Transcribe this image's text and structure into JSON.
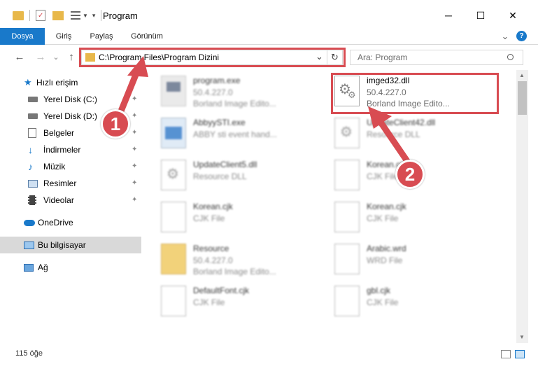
{
  "window": {
    "title": "Program",
    "minimize": "─",
    "maximize": "☐",
    "close": "✕"
  },
  "ribbon": {
    "tabs": [
      {
        "label": "Dosya",
        "active": true
      },
      {
        "label": "Giriş",
        "active": false
      },
      {
        "label": "Paylaş",
        "active": false
      },
      {
        "label": "Görünüm",
        "active": false
      }
    ],
    "expand": "⌄",
    "help": "?"
  },
  "nav": {
    "back": "←",
    "forward": "→",
    "recent": "⌄",
    "up": "↑",
    "address": "C:\\Program Files\\Program Dizini",
    "address_dropdown": "⌄",
    "refresh": "↻",
    "search_placeholder": "Ara: Program"
  },
  "sidebar": {
    "items": [
      {
        "label": "Hızlı erişim",
        "icon": "star-icon",
        "pinned": false
      },
      {
        "label": "Yerel Disk (C:)",
        "icon": "drive-icon",
        "pinned": true
      },
      {
        "label": "Yerel Disk (D:)",
        "icon": "drive-icon",
        "pinned": true
      },
      {
        "label": "Belgeler",
        "icon": "document-icon",
        "pinned": true
      },
      {
        "label": "İndirmeler",
        "icon": "download-icon",
        "pinned": true
      },
      {
        "label": "Müzik",
        "icon": "music-icon",
        "pinned": true
      },
      {
        "label": "Resimler",
        "icon": "image-icon",
        "pinned": true
      },
      {
        "label": "Videolar",
        "icon": "film-icon",
        "pinned": true
      },
      {
        "label": "OneDrive",
        "icon": "cloud-icon",
        "pinned": false
      },
      {
        "label": "Bu bilgisayar",
        "icon": "computer-icon",
        "pinned": false,
        "selected": true
      },
      {
        "label": "Ağ",
        "icon": "network-icon",
        "pinned": false
      }
    ]
  },
  "files": [
    {
      "name": "program.exe",
      "line2": "50.4.227.0",
      "line3": "Borland Image Edito...",
      "icon": "exe-icon",
      "blur": true
    },
    {
      "name": "imged32.dll",
      "line2": "50.4.227.0",
      "line3": "Borland Image Edito...",
      "icon": "dll-gear-icon",
      "blur": false
    },
    {
      "name": "AbbyySTI.exe",
      "line2": "ABBY sti event hand...",
      "line3": "",
      "icon": "exe-window-icon",
      "blur": true
    },
    {
      "name": "UpdateClient42.dll",
      "line2": "Resource DLL",
      "line3": "",
      "icon": "dll-gear-icon",
      "blur": true
    },
    {
      "name": "UpdateClient5.dll",
      "line2": "Resource DLL",
      "line3": "",
      "icon": "dll-gear-icon",
      "blur": true
    },
    {
      "name": "Korean.cjk",
      "line2": "CJK File",
      "line3": "",
      "icon": "file-icon",
      "blur": true
    },
    {
      "name": "Korean.cjk",
      "line2": "CJK File",
      "line3": "",
      "icon": "file-icon",
      "blur": true
    },
    {
      "name": "Korean.cjk",
      "line2": "CJK File",
      "line3": "",
      "icon": "file-icon",
      "blur": true
    },
    {
      "name": "Resource",
      "line2": "50.4.227.0",
      "line3": "Borland Image Edito...",
      "icon": "folder-file-icon",
      "blur": true
    },
    {
      "name": "Arabic.wrd",
      "line2": "WRD File",
      "line3": "",
      "icon": "file-icon",
      "blur": true
    },
    {
      "name": "DefaultFont.cjk",
      "line2": "CJK File",
      "line3": "",
      "icon": "file-icon",
      "blur": true
    },
    {
      "name": "gbl.cjk",
      "line2": "CJK File",
      "line3": "",
      "icon": "file-icon",
      "blur": true
    }
  ],
  "status": {
    "count": "115 öğe"
  },
  "annotations": {
    "badge1": "1",
    "badge2": "2"
  },
  "colors": {
    "accent": "#1979ca",
    "callout": "#d84c52",
    "folder": "#e8b84a"
  }
}
